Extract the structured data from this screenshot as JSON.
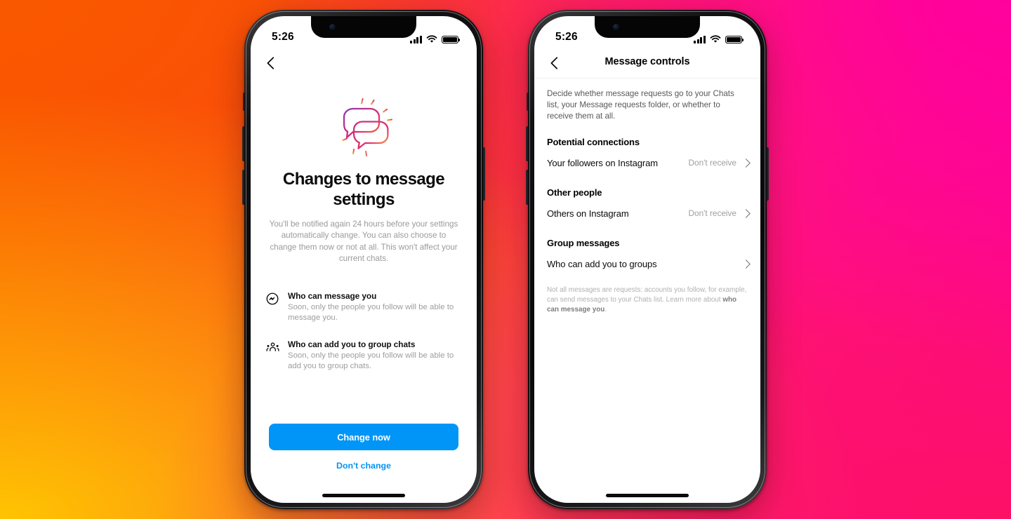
{
  "background": {
    "gradient_colors": [
      "#fa5800",
      "#ffc800",
      "#ff009e",
      "#fc1263"
    ]
  },
  "theme": {
    "accent_blue": "#0095f6",
    "text_primary": "#0a0a0a",
    "text_muted": "#9e9e9e"
  },
  "status_bar": {
    "time": "5:26",
    "signal_icon": "cellular-signal-icon",
    "wifi_icon": "wifi-icon",
    "battery_icon": "battery-icon"
  },
  "left_phone": {
    "nav": {
      "back_icon": "chevron-left-icon"
    },
    "illustration": "speech-bubbles-icon",
    "title": "Changes to message settings",
    "subtitle": "You'll be notified again 24 hours before your settings automatically change. You can also choose to change them now or not at all. This won't affect your current chats.",
    "items": [
      {
        "icon": "messenger-chat-icon",
        "title": "Who can message you",
        "description": "Soon, only the people you follow will be able to message you."
      },
      {
        "icon": "group-people-icon",
        "title": "Who can add you to group chats",
        "description": "Soon, only the people you follow will be able to add you to group chats."
      }
    ],
    "primary_button": "Change now",
    "secondary_button": "Don't change"
  },
  "right_phone": {
    "nav": {
      "back_icon": "chevron-left-icon",
      "title": "Message controls"
    },
    "intro": "Decide whether message requests go to your Chats list, your Message requests folder, or whether to receive them at all.",
    "sections": [
      {
        "heading": "Potential connections",
        "rows": [
          {
            "label": "Your followers on Instagram",
            "value": "Don't receive",
            "chevron": "chevron-right-icon"
          }
        ]
      },
      {
        "heading": "Other people",
        "rows": [
          {
            "label": "Others on Instagram",
            "value": "Don't receive",
            "chevron": "chevron-right-icon"
          }
        ]
      },
      {
        "heading": "Group messages",
        "rows": [
          {
            "label": "Who can add you to groups",
            "value": "",
            "chevron": "chevron-right-icon"
          }
        ]
      }
    ],
    "footnote_prefix": "Not all messages are requests: accounts you follow, for example, can send messages to your Chats list. Learn more about ",
    "footnote_link": "who can message you",
    "footnote_suffix": "."
  }
}
